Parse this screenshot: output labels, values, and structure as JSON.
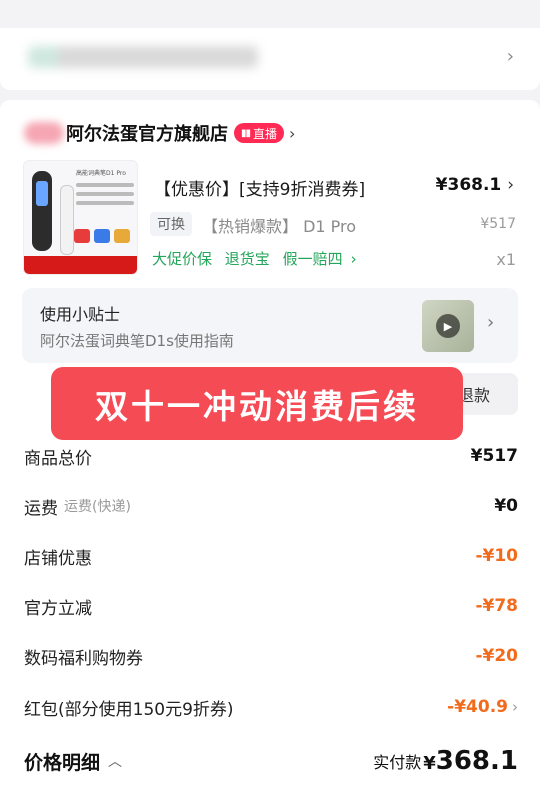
{
  "store": {
    "name": "阿尔法蛋官方旗舰店",
    "live_label": "直播"
  },
  "product": {
    "title": "【优惠价】[支持9折消费券]",
    "price": "¥368.1",
    "swap_badge": "可换",
    "variant": "【热销爆款】 D1 Pro",
    "original_price": "¥517",
    "guarantees": [
      "大促价保",
      "退货宝",
      "假一赔四"
    ],
    "quantity": "x1",
    "thumb_title": "高能词典笔D1 Pro"
  },
  "tips": {
    "title": "使用小贴士",
    "subtitle": "阿尔法蛋词典笔D1s使用指南"
  },
  "behind_button": "退款",
  "overlay_banner": "双十一冲动消费后续",
  "costs": [
    {
      "label": "商品总价",
      "sub": "",
      "value": "¥517",
      "discount": false
    },
    {
      "label": "运费",
      "sub": "运费(快递)",
      "value": "¥0",
      "discount": false
    },
    {
      "label": "店铺优惠",
      "sub": "",
      "value": "-¥10",
      "discount": true
    },
    {
      "label": "官方立减",
      "sub": "",
      "value": "-¥78",
      "discount": true
    },
    {
      "label": "数码福利购物券",
      "sub": "",
      "value": "-¥20",
      "discount": true
    },
    {
      "label": "红包(部分使用150元9折券)",
      "sub": "",
      "value": "-¥40.9",
      "discount": true
    }
  ],
  "footer": {
    "detail_label": "价格明细",
    "paid_label": "实付款",
    "paid_currency": "¥",
    "paid_amount": "368.1"
  },
  "colors": {
    "live_red": "#ff2b54",
    "guarantee_green": "#23a55a",
    "discount_orange": "#f26b1d",
    "banner_red": "#f54b55"
  }
}
